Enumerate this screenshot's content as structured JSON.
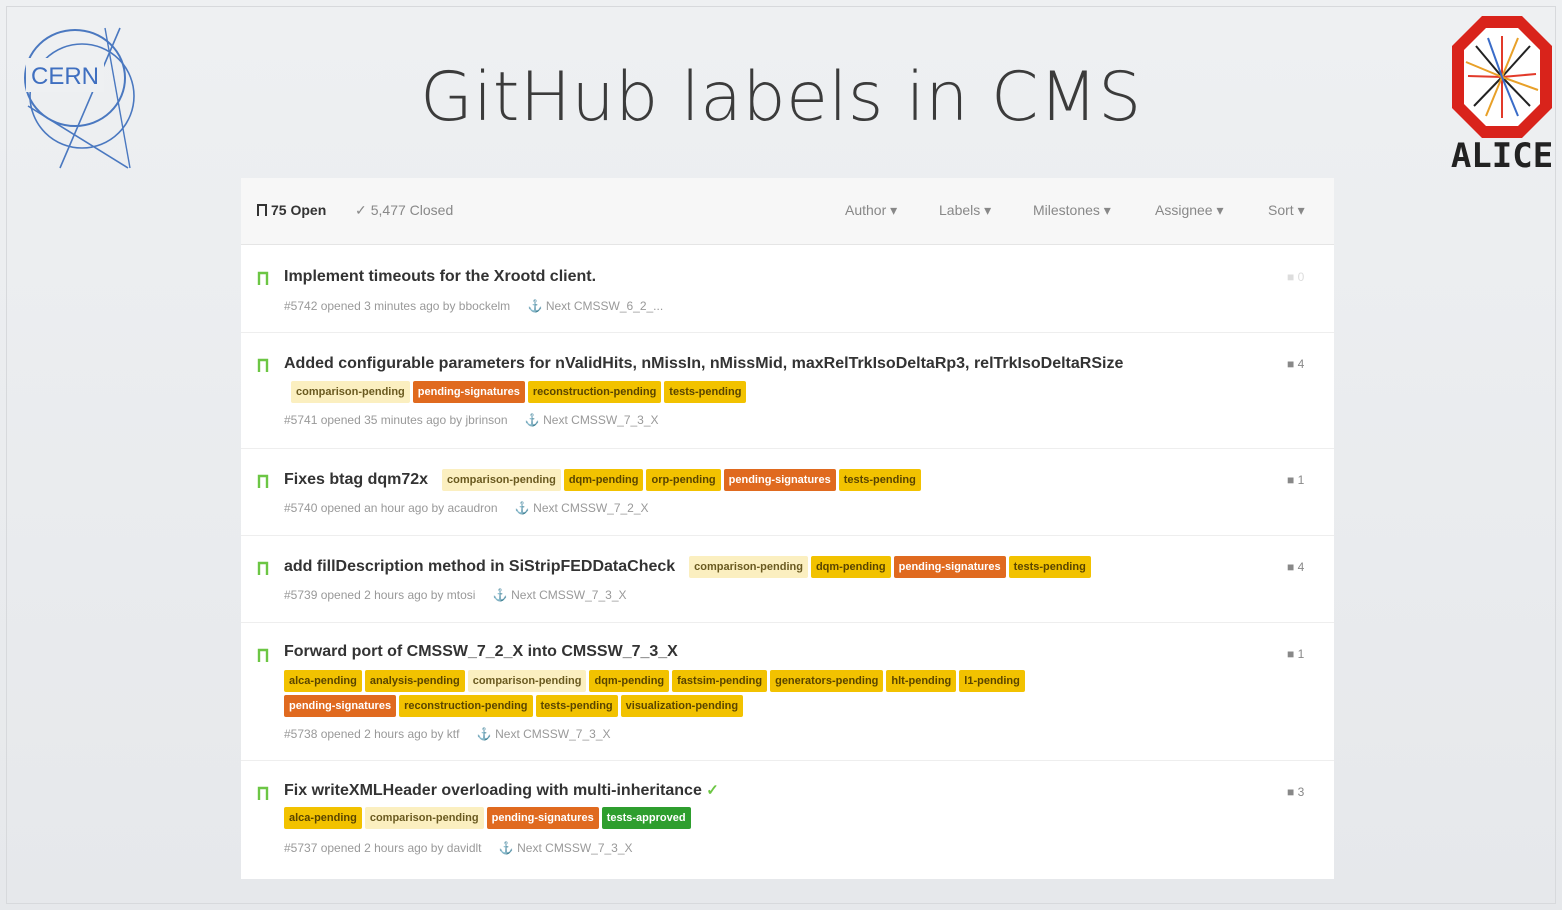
{
  "slide": {
    "title": "GitHub labels in CMS"
  },
  "logos": {
    "cern_text": "CERN",
    "alice_text": "ALICE"
  },
  "toolbar": {
    "open": "75 Open",
    "closed": "5,477 Closed",
    "menus": [
      "Author ▾",
      "Labels ▾",
      "Milestones ▾",
      "Assignee ▾",
      "Sort ▾"
    ]
  },
  "issues": [
    {
      "title": "Implement timeouts for the Xrootd client.",
      "meta": "#5742 opened 3 minutes ago by bbockelm",
      "milestone": "Next CMSSW_6_2_...",
      "comments": "0"
    },
    {
      "title": "Added configurable parameters for nValidHits, nMissIn, nMissMid, maxRelTrkIsoDeltaRp3, relTrkIsoDeltaRSize",
      "labels": [
        "comparison-pending",
        "pending-signatures",
        "reconstruction-pending",
        "tests-pending"
      ],
      "meta": "#5741 opened 35 minutes ago by jbrinson",
      "milestone": "Next CMSSW_7_3_X",
      "comments": "4"
    },
    {
      "title": "Fixes btag dqm72x",
      "labels": [
        "comparison-pending",
        "dqm-pending",
        "orp-pending",
        "pending-signatures",
        "tests-pending"
      ],
      "meta": "#5740 opened an hour ago by acaudron",
      "milestone": "Next CMSSW_7_2_X",
      "comments": "1"
    },
    {
      "title": "add fillDescription method in SiStripFEDDataCheck",
      "labels": [
        "comparison-pending",
        "dqm-pending",
        "pending-signatures",
        "tests-pending"
      ],
      "meta": "#5739 opened 2 hours ago by mtosi",
      "milestone": "Next CMSSW_7_3_X",
      "comments": "4"
    },
    {
      "title": "Forward port of CMSSW_7_2_X into CMSSW_7_3_X",
      "labels_row1": [
        "alca-pending",
        "analysis-pending",
        "comparison-pending",
        "dqm-pending",
        "fastsim-pending",
        "generators-pending",
        "hlt-pending",
        "l1-pending"
      ],
      "labels_row2": [
        "pending-signatures",
        "reconstruction-pending",
        "tests-pending",
        "visualization-pending"
      ],
      "meta": "#5738 opened 2 hours ago by ktf",
      "milestone": "Next CMSSW_7_3_X",
      "comments": "1"
    },
    {
      "title": "Fix writeXMLHeader overloading with multi-inheritance",
      "labels": [
        "alca-pending",
        "comparison-pending",
        "pending-signatures",
        "tests-approved"
      ],
      "meta": "#5737 opened 2 hours ago by davidlt",
      "milestone": "Next CMSSW_7_3_X",
      "comments": "3"
    }
  ],
  "colors": {
    "label_pending": "#f2c200",
    "label_comparison": "#fbefc0",
    "label_signatures": "#e06a1f",
    "label_approved": "#2e9e2e",
    "open_icon": "#6cc644"
  },
  "icons": [
    "issue-opened-icon",
    "check-icon",
    "milestone-icon",
    "comment-icon"
  ]
}
